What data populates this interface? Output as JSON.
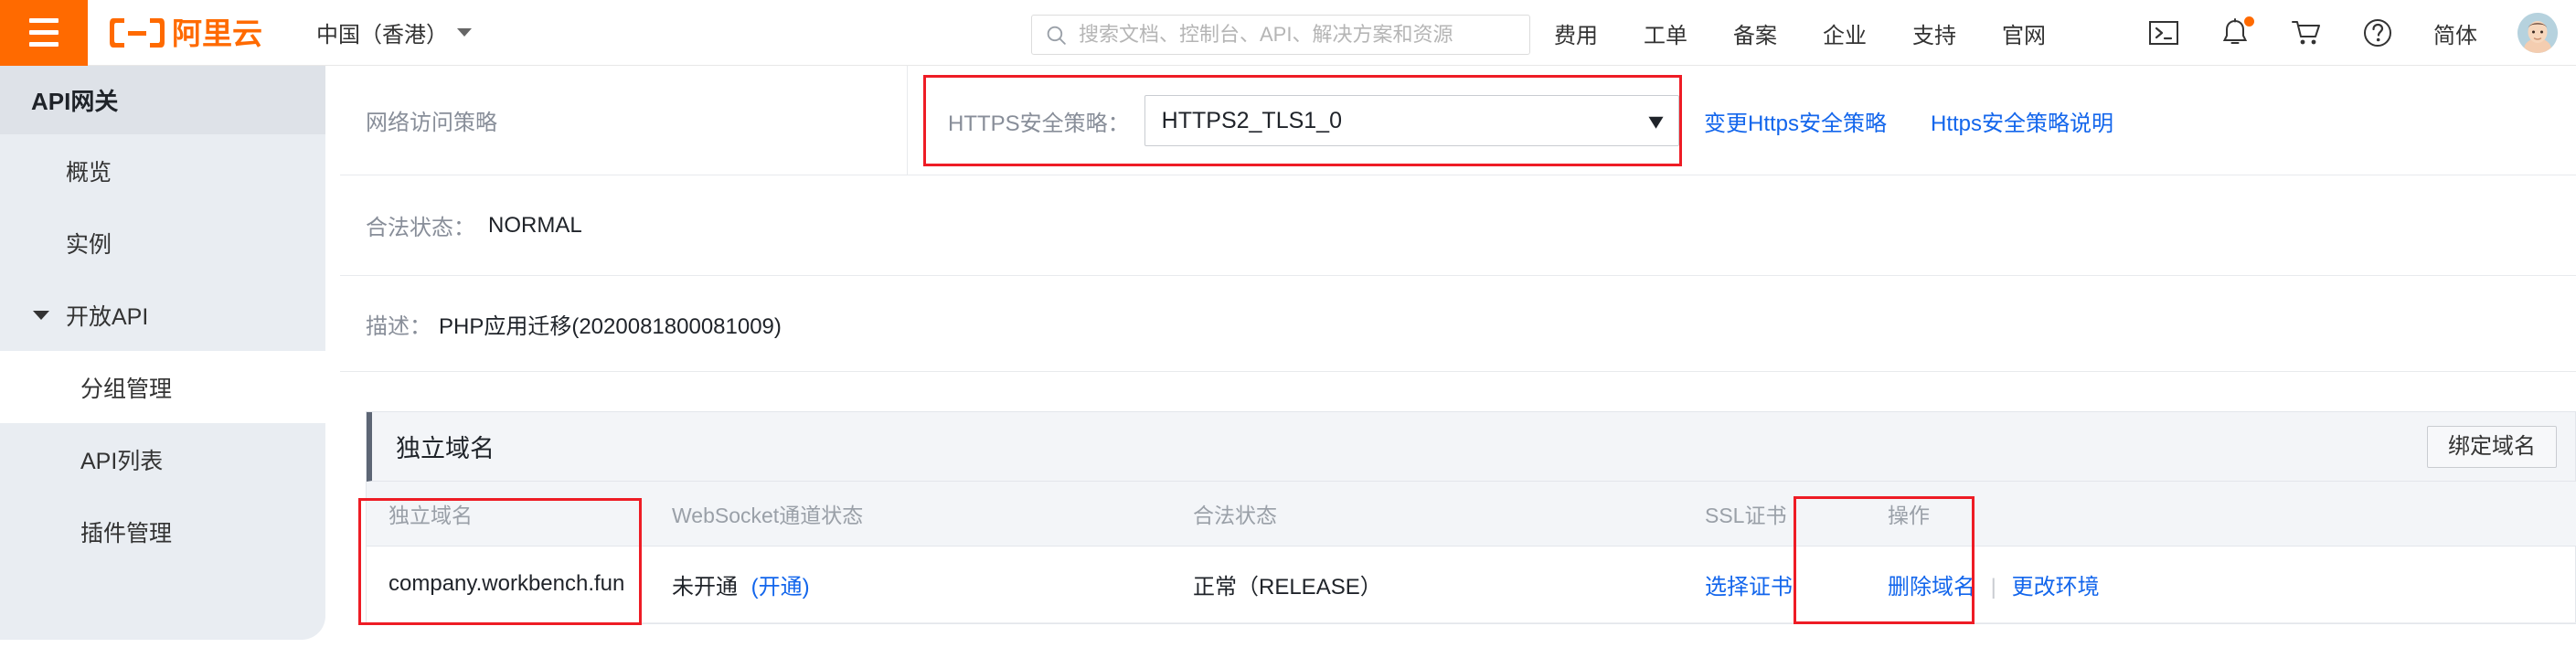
{
  "header": {
    "menu_icon": "hamburger-icon",
    "logo_text": "阿里云",
    "region": "中国（香港）",
    "search": {
      "icon": "search-icon",
      "placeholder": "搜索文档、控制台、API、解决方案和资源",
      "value": ""
    },
    "nav": [
      {
        "label": "费用"
      },
      {
        "label": "工单"
      },
      {
        "label": "备案"
      },
      {
        "label": "企业"
      },
      {
        "label": "支持"
      },
      {
        "label": "官网"
      }
    ],
    "icons": [
      {
        "name": "terminal-icon"
      },
      {
        "name": "bell-icon",
        "badge": true
      },
      {
        "name": "cart-icon"
      },
      {
        "name": "help-icon"
      }
    ],
    "language": "简体",
    "avatar": "user-avatar"
  },
  "sidebar": {
    "title": "API网关",
    "items": [
      {
        "label": "概览",
        "level": 1,
        "active": false
      },
      {
        "label": "实例",
        "level": 1,
        "active": false
      },
      {
        "label": "开放API",
        "level": 1,
        "active": false,
        "expandable": true
      },
      {
        "label": "分组管理",
        "level": 2,
        "active": true
      },
      {
        "label": "API列表",
        "level": 2,
        "active": false
      },
      {
        "label": "插件管理",
        "level": 2,
        "active": false
      }
    ]
  },
  "main": {
    "network_policy": {
      "label": "网络访问策略",
      "https_policy_label": "HTTPS安全策略：",
      "https_policy_value": "HTTPS2_TLS1_0",
      "options": [
        "HTTPS2_TLS1_0"
      ],
      "links": [
        {
          "label": "变更Https安全策略"
        },
        {
          "label": "Https安全策略说明"
        }
      ]
    },
    "legal_status": {
      "label": "合法状态：",
      "value": "NORMAL"
    },
    "description": {
      "label": "描述：",
      "value": "PHP应用迁移(2020081800081009)"
    },
    "domain_panel": {
      "title": "独立域名",
      "bind_button": "绑定域名",
      "columns": [
        "独立域名",
        "WebSocket通道状态",
        "合法状态",
        "SSL证书",
        "操作"
      ],
      "rows": [
        {
          "domain": "company.workbench.fun",
          "websocket_status": "未开通",
          "websocket_action": "(开通)",
          "legal_status": "正常（RELEASE）",
          "ssl_cert": "选择证书",
          "actions": [
            {
              "label": "删除域名"
            },
            {
              "label": "更改环境"
            }
          ],
          "action_separator": "|"
        }
      ]
    }
  },
  "annotations": {
    "highlight_color": "#ee1c25",
    "boxes": [
      {
        "name": "https-policy-highlight"
      },
      {
        "name": "domain-column-highlight"
      },
      {
        "name": "ssl-column-highlight"
      }
    ]
  }
}
